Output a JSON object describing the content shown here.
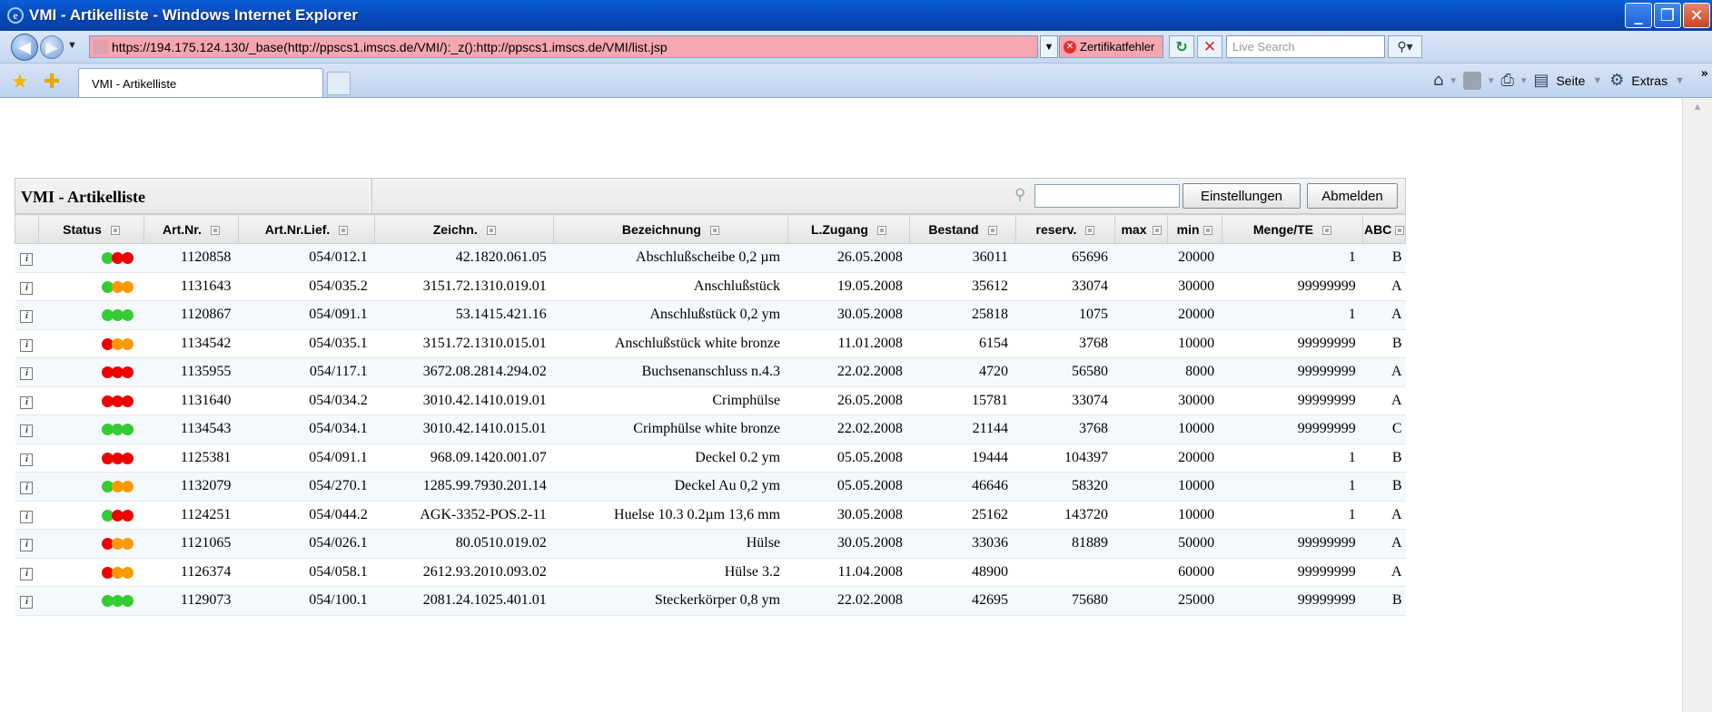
{
  "window": {
    "title": "VMI - Artikelliste - Windows Internet Explorer",
    "minimize_glyph": "_",
    "maximize_glyph": "❐",
    "close_glyph": "✕"
  },
  "addressbar": {
    "url": "https://194.175.124.130/_base(http://ppscs1.imscs.de/VMI/):_z():http://ppscs1.imscs.de/VMI/list.jsp",
    "cert_error": "Zertifikatfehler",
    "search_placeholder": "Live Search"
  },
  "tabs": [
    {
      "label": "VMI - Artikelliste"
    }
  ],
  "commandbar": {
    "page_label": "Seite",
    "extras_label": "Extras"
  },
  "panel": {
    "title": "VMI - Artikelliste",
    "search_value": "",
    "settings_button": "Einstellungen",
    "logout_button": "Abmelden"
  },
  "status_colors": {
    "green": "#33cc33",
    "orange": "#ff9900",
    "red": "#ee0000"
  },
  "table": {
    "columns": [
      "",
      "Status",
      "Art.Nr.",
      "Art.Nr.Lief.",
      "Zeichn.",
      "Bezeichnung",
      "L.Zugang",
      "Bestand",
      "reserv.",
      "max",
      "min",
      "Menge/TE",
      "ABC"
    ],
    "rows": [
      {
        "status": [
          "green",
          "red",
          "red"
        ],
        "artnr": "1120858",
        "artnr_lief": "054/012.1",
        "zeichn": "42.1820.061.05",
        "bezeichnung": "Abschlußscheibe 0,2 µm",
        "lzugang": "26.05.2008",
        "bestand": "36011",
        "reserv": "65696",
        "max": "",
        "min": "20000",
        "menge_te": "1",
        "abc": "B"
      },
      {
        "status": [
          "green",
          "orange",
          "orange"
        ],
        "artnr": "1131643",
        "artnr_lief": "054/035.2",
        "zeichn": "3151.72.1310.019.01",
        "bezeichnung": "Anschlußstück",
        "lzugang": "19.05.2008",
        "bestand": "35612",
        "reserv": "33074",
        "max": "",
        "min": "30000",
        "menge_te": "99999999",
        "abc": "A"
      },
      {
        "status": [
          "green",
          "green",
          "green"
        ],
        "artnr": "1120867",
        "artnr_lief": "054/091.1",
        "zeichn": "53.1415.421.16",
        "bezeichnung": "Anschlußstück 0,2 ym",
        "lzugang": "30.05.2008",
        "bestand": "25818",
        "reserv": "1075",
        "max": "",
        "min": "20000",
        "menge_te": "1",
        "abc": "A"
      },
      {
        "status": [
          "red",
          "orange",
          "orange"
        ],
        "artnr": "1134542",
        "artnr_lief": "054/035.1",
        "zeichn": "3151.72.1310.015.01",
        "bezeichnung": "Anschlußstück white bronze",
        "lzugang": "11.01.2008",
        "bestand": "6154",
        "reserv": "3768",
        "max": "",
        "min": "10000",
        "menge_te": "99999999",
        "abc": "B"
      },
      {
        "status": [
          "red",
          "red",
          "red"
        ],
        "artnr": "1135955",
        "artnr_lief": "054/117.1",
        "zeichn": "3672.08.2814.294.02",
        "bezeichnung": "Buchsenanschluss n.4.3",
        "lzugang": "22.02.2008",
        "bestand": "4720",
        "reserv": "56580",
        "max": "",
        "min": "8000",
        "menge_te": "99999999",
        "abc": "A"
      },
      {
        "status": [
          "red",
          "red",
          "red"
        ],
        "artnr": "1131640",
        "artnr_lief": "054/034.2",
        "zeichn": "3010.42.1410.019.01",
        "bezeichnung": "Crimphülse",
        "lzugang": "26.05.2008",
        "bestand": "15781",
        "reserv": "33074",
        "max": "",
        "min": "30000",
        "menge_te": "99999999",
        "abc": "A"
      },
      {
        "status": [
          "green",
          "green",
          "green"
        ],
        "artnr": "1134543",
        "artnr_lief": "054/034.1",
        "zeichn": "3010.42.1410.015.01",
        "bezeichnung": "Crimphülse white bronze",
        "lzugang": "22.02.2008",
        "bestand": "21144",
        "reserv": "3768",
        "max": "",
        "min": "10000",
        "menge_te": "99999999",
        "abc": "C"
      },
      {
        "status": [
          "red",
          "red",
          "red"
        ],
        "artnr": "1125381",
        "artnr_lief": "054/091.1",
        "zeichn": "968.09.1420.001.07",
        "bezeichnung": "Deckel 0.2 ym",
        "lzugang": "05.05.2008",
        "bestand": "19444",
        "reserv": "104397",
        "max": "",
        "min": "20000",
        "menge_te": "1",
        "abc": "B"
      },
      {
        "status": [
          "green",
          "orange",
          "orange"
        ],
        "artnr": "1132079",
        "artnr_lief": "054/270.1",
        "zeichn": "1285.99.7930.201.14",
        "bezeichnung": "Deckel Au 0,2 ym",
        "lzugang": "05.05.2008",
        "bestand": "46646",
        "reserv": "58320",
        "max": "",
        "min": "10000",
        "menge_te": "1",
        "abc": "B"
      },
      {
        "status": [
          "green",
          "red",
          "red"
        ],
        "artnr": "1124251",
        "artnr_lief": "054/044.2",
        "zeichn": "AGK-3352-POS.2-11",
        "bezeichnung": "Huelse 10.3 0.2µm 13,6 mm",
        "lzugang": "30.05.2008",
        "bestand": "25162",
        "reserv": "143720",
        "max": "",
        "min": "10000",
        "menge_te": "1",
        "abc": "A"
      },
      {
        "status": [
          "red",
          "orange",
          "orange"
        ],
        "artnr": "1121065",
        "artnr_lief": "054/026.1",
        "zeichn": "80.0510.019.02",
        "bezeichnung": "Hülse",
        "lzugang": "30.05.2008",
        "bestand": "33036",
        "reserv": "81889",
        "max": "",
        "min": "50000",
        "menge_te": "99999999",
        "abc": "A"
      },
      {
        "status": [
          "red",
          "orange",
          "orange"
        ],
        "artnr": "1126374",
        "artnr_lief": "054/058.1",
        "zeichn": "2612.93.2010.093.02",
        "bezeichnung": "Hülse 3.2",
        "lzugang": "11.04.2008",
        "bestand": "48900",
        "reserv": "",
        "max": "",
        "min": "60000",
        "menge_te": "99999999",
        "abc": "A"
      },
      {
        "status": [
          "green",
          "green",
          "green"
        ],
        "artnr": "1129073",
        "artnr_lief": "054/100.1",
        "zeichn": "2081.24.1025.401.01",
        "bezeichnung": "Steckerkörper 0,8 ym",
        "lzugang": "22.02.2008",
        "bestand": "42695",
        "reserv": "75680",
        "max": "",
        "min": "25000",
        "menge_te": "99999999",
        "abc": "B"
      }
    ]
  }
}
